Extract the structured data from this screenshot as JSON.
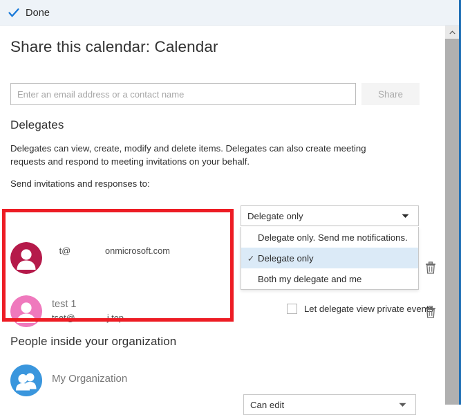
{
  "commandbar": {
    "done_label": "Done",
    "done_icon": "checkmark-icon",
    "accent_color": "#1a7ad9",
    "background": "#eef3f8"
  },
  "header": {
    "title": "Share this calendar: Calendar"
  },
  "share": {
    "input_placeholder": "Enter an email address or a contact name",
    "input_value": "",
    "button_label": "Share",
    "button_disabled": true
  },
  "delegates": {
    "heading": "Delegates",
    "description": "Delegates can view, create, modify and delete items. Delegates can also create meeting requests and respond to meeting invitations on your behalf.",
    "send_label": "Send invitations and responses to:",
    "send_combo": {
      "value": "Delegate only",
      "expanded": true,
      "caret_icon": "chevron-down-icon",
      "options": [
        {
          "label": "Delegate only. Send me notifications.",
          "selected": false
        },
        {
          "label": "Delegate only",
          "selected": true
        },
        {
          "label": "Both my delegate and me",
          "selected": false
        }
      ],
      "selected_highlight": "#dbeaf7",
      "check_icon": "checkmark-icon"
    },
    "rows": [
      {
        "name": "",
        "email": "   t@              onmicrosoft.com",
        "avatar_color": "#b51a4a",
        "avatar_icon": "person-icon",
        "show_private_checkbox": false,
        "private_label": "",
        "private_checked": false,
        "delete_icon": "trash-icon"
      },
      {
        "name": "test 1",
        "email": "tset@             j.top",
        "avatar_color": "#ef79bd",
        "avatar_icon": "person-icon",
        "show_private_checkbox": true,
        "private_label": "Let delegate view private events",
        "private_checked": false,
        "delete_icon": "trash-icon"
      }
    ]
  },
  "organization": {
    "heading": "People inside your organization",
    "row_name": "My Organization",
    "avatar_color": "#3a96dd",
    "avatar_icon": "people-icon",
    "permission_combo": {
      "value": "Can edit",
      "caret_icon": "chevron-down-icon"
    }
  },
  "annotation": {
    "color": "#ed1c24",
    "shape": "rectangle-highlight"
  },
  "scrollbar": {
    "up_arrow_icon": "chevron-up-icon",
    "thumb_color": "#b0b0b0"
  }
}
